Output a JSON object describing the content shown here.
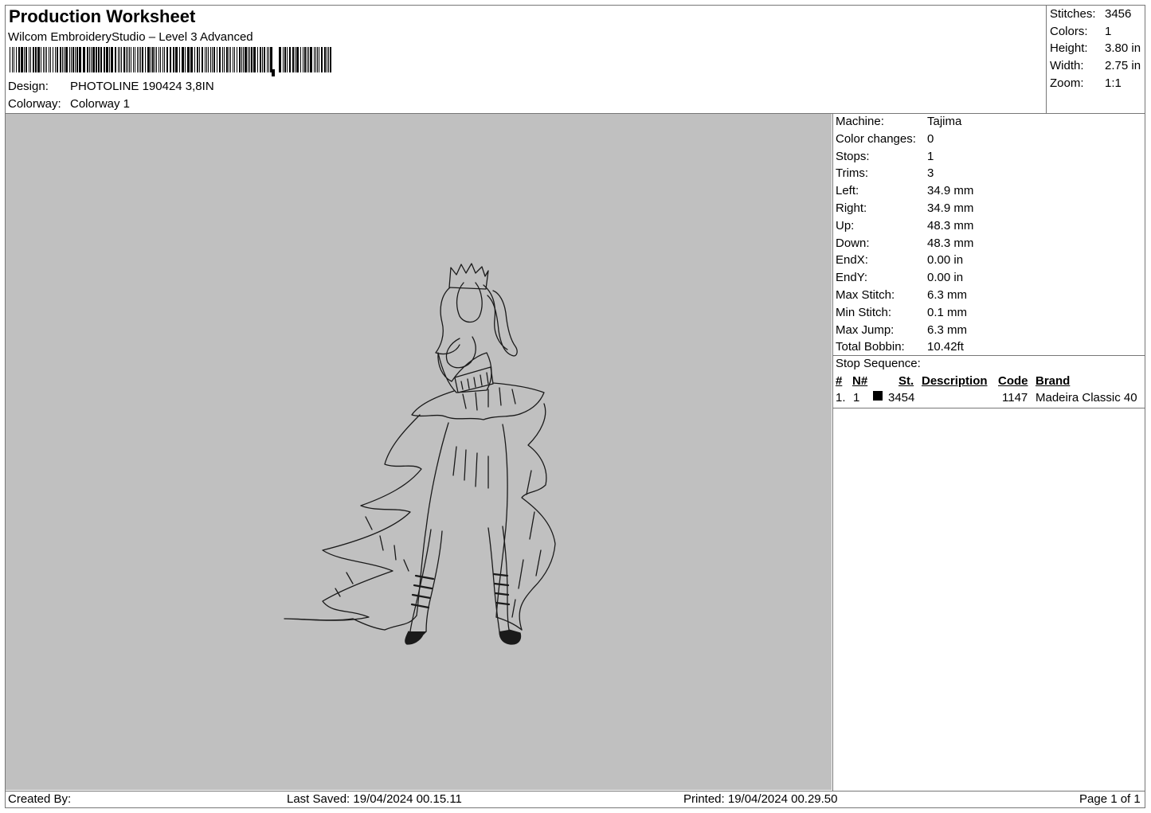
{
  "header": {
    "title": "Production Worksheet",
    "software": "Wilcom EmbroideryStudio – Level 3 Advanced",
    "design_label": "Design:",
    "design_value": "PHOTOLINE 190424 3,8IN",
    "colorway_label": "Colorway:",
    "colorway_value": "Colorway 1"
  },
  "summary": [
    {
      "label": "Stitches:",
      "value": "3456"
    },
    {
      "label": "Colors:",
      "value": "1"
    },
    {
      "label": "Height:",
      "value": "3.80 in"
    },
    {
      "label": "Width:",
      "value": "2.75 in"
    },
    {
      "label": "Zoom:",
      "value": "1:1"
    }
  ],
  "machine_info": [
    {
      "label": "Machine:",
      "value": "Tajima"
    },
    {
      "label": "Color changes:",
      "value": "0"
    },
    {
      "label": "Stops:",
      "value": "1"
    },
    {
      "label": "Trims:",
      "value": "3"
    },
    {
      "label": "Left:",
      "value": "34.9 mm"
    },
    {
      "label": "Right:",
      "value": "34.9 mm"
    },
    {
      "label": "Up:",
      "value": "48.3 mm"
    },
    {
      "label": "Down:",
      "value": "48.3 mm"
    },
    {
      "label": "EndX:",
      "value": "0.00 in"
    },
    {
      "label": "EndY:",
      "value": "0.00 in"
    },
    {
      "label": "Max Stitch:",
      "value": "6.3 mm"
    },
    {
      "label": "Min Stitch:",
      "value": "0.1 mm"
    },
    {
      "label": "Max Jump:",
      "value": "6.3 mm"
    },
    {
      "label": "Total Bobbin:",
      "value": "10.42ft"
    }
  ],
  "stop_sequence": {
    "label": "Stop Sequence:",
    "columns": {
      "num": "#",
      "needle": "N#",
      "stitches": "St.",
      "description": "Description",
      "code": "Code",
      "brand": "Brand"
    },
    "rows": [
      {
        "num": "1.",
        "needle": "1",
        "stitches": "3454",
        "description": "",
        "code": "1147",
        "brand": "Madeira Classic 40",
        "color": "#000000"
      }
    ]
  },
  "colors": {
    "canvas": "#c0c0c0",
    "thread": "#1a1a1a",
    "border": "#777777"
  },
  "footer": {
    "created_by": "Created By:",
    "last_saved": "Last Saved: 19/04/2024 00.15.11",
    "printed": "Printed: 19/04/2024 00.29.50",
    "page": "Page 1 of 1"
  }
}
